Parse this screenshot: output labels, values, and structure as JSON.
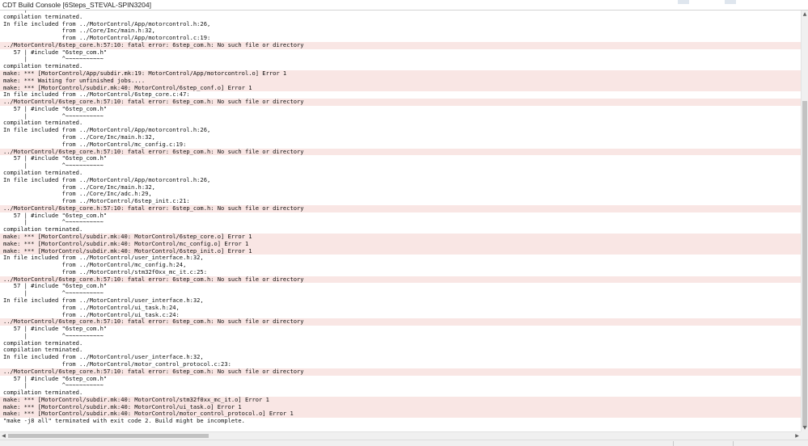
{
  "window": {
    "title": "CDT Build Console [6Steps_STEVAL-SPIN3204]"
  },
  "scrollbars": {
    "up_arrow": "▲",
    "down_arrow": "▼",
    "left_arrow": "◀",
    "right_arrow": "▶"
  },
  "colors": {
    "error_line_background": "#f9e6e4",
    "text": "#111111"
  },
  "console": {
    "lines": [
      {
        "text": "      |          ^~~~~~~~~~~~",
        "type": "normal"
      },
      {
        "text": "compilation terminated.",
        "type": "normal"
      },
      {
        "text": "In file included from ../MotorControl/App/motorcontrol.h:26,",
        "type": "normal"
      },
      {
        "text": "                 from ../Core/Inc/main.h:32,",
        "type": "normal"
      },
      {
        "text": "                 from ../MotorControl/App/motorcontrol.c:19:",
        "type": "normal"
      },
      {
        "text": "../MotorControl/6step_core.h:57:10: fatal error: 6step_com.h: No such file or directory",
        "type": "error"
      },
      {
        "text": "   57 | #include \"6step_com.h\"",
        "type": "normal"
      },
      {
        "text": "      |          ^~~~~~~~~~~~",
        "type": "normal"
      },
      {
        "text": "compilation terminated.",
        "type": "normal"
      },
      {
        "text": "make: *** [MotorControl/App/subdir.mk:19: MotorControl/App/motorcontrol.o] Error 1",
        "type": "error"
      },
      {
        "text": "make: *** Waiting for unfinished jobs....",
        "type": "error"
      },
      {
        "text": "make: *** [MotorControl/subdir.mk:40: MotorControl/6step_conf.o] Error 1",
        "type": "error"
      },
      {
        "text": "In file included from ../MotorControl/6step_core.c:47:",
        "type": "normal"
      },
      {
        "text": "../MotorControl/6step_core.h:57:10: fatal error: 6step_com.h: No such file or directory",
        "type": "error"
      },
      {
        "text": "   57 | #include \"6step_com.h\"",
        "type": "normal"
      },
      {
        "text": "      |          ^~~~~~~~~~~~",
        "type": "normal"
      },
      {
        "text": "compilation terminated.",
        "type": "normal"
      },
      {
        "text": "In file included from ../MotorControl/App/motorcontrol.h:26,",
        "type": "normal"
      },
      {
        "text": "                 from ../Core/Inc/main.h:32,",
        "type": "normal"
      },
      {
        "text": "                 from ../MotorControl/mc_config.c:19:",
        "type": "normal"
      },
      {
        "text": "../MotorControl/6step_core.h:57:10: fatal error: 6step_com.h: No such file or directory",
        "type": "error"
      },
      {
        "text": "   57 | #include \"6step_com.h\"",
        "type": "normal"
      },
      {
        "text": "      |          ^~~~~~~~~~~~",
        "type": "normal"
      },
      {
        "text": "compilation terminated.",
        "type": "normal"
      },
      {
        "text": "In file included from ../MotorControl/App/motorcontrol.h:26,",
        "type": "normal"
      },
      {
        "text": "                 from ../Core/Inc/main.h:32,",
        "type": "normal"
      },
      {
        "text": "                 from ../Core/Inc/adc.h:29,",
        "type": "normal"
      },
      {
        "text": "                 from ../MotorControl/6step_init.c:21:",
        "type": "normal"
      },
      {
        "text": "../MotorControl/6step_core.h:57:10: fatal error: 6step_com.h: No such file or directory",
        "type": "error"
      },
      {
        "text": "   57 | #include \"6step_com.h\"",
        "type": "normal"
      },
      {
        "text": "      |          ^~~~~~~~~~~~",
        "type": "normal"
      },
      {
        "text": "compilation terminated.",
        "type": "normal"
      },
      {
        "text": "make: *** [MotorControl/subdir.mk:40: MotorControl/6step_core.o] Error 1",
        "type": "error"
      },
      {
        "text": "make: *** [MotorControl/subdir.mk:40: MotorControl/mc_config.o] Error 1",
        "type": "error"
      },
      {
        "text": "make: *** [MotorControl/subdir.mk:40: MotorControl/6step_init.o] Error 1",
        "type": "error"
      },
      {
        "text": "In file included from ../MotorControl/user_interface.h:32,",
        "type": "normal"
      },
      {
        "text": "                 from ../MotorControl/mc_config.h:24,",
        "type": "normal"
      },
      {
        "text": "                 from ../MotorControl/stm32f0xx_mc_it.c:25:",
        "type": "normal"
      },
      {
        "text": "../MotorControl/6step_core.h:57:10: fatal error: 6step_com.h: No such file or directory",
        "type": "error"
      },
      {
        "text": "   57 | #include \"6step_com.h\"",
        "type": "normal"
      },
      {
        "text": "      |          ^~~~~~~~~~~~",
        "type": "normal"
      },
      {
        "text": "In file included from ../MotorControl/user_interface.h:32,",
        "type": "normal"
      },
      {
        "text": "                 from ../MotorControl/ui_task.h:24,",
        "type": "normal"
      },
      {
        "text": "                 from ../MotorControl/ui_task.c:24:",
        "type": "normal"
      },
      {
        "text": "../MotorControl/6step_core.h:57:10: fatal error: 6step_com.h: No such file or directory",
        "type": "error"
      },
      {
        "text": "   57 | #include \"6step_com.h\"",
        "type": "normal"
      },
      {
        "text": "      |          ^~~~~~~~~~~~",
        "type": "normal"
      },
      {
        "text": "compilation terminated.",
        "type": "normal"
      },
      {
        "text": "compilation terminated.",
        "type": "normal"
      },
      {
        "text": "In file included from ../MotorControl/user_interface.h:32,",
        "type": "normal"
      },
      {
        "text": "                 from ../MotorControl/motor_control_protocol.c:23:",
        "type": "normal"
      },
      {
        "text": "../MotorControl/6step_core.h:57:10: fatal error: 6step_com.h: No such file or directory",
        "type": "error"
      },
      {
        "text": "   57 | #include \"6step_com.h\"",
        "type": "normal"
      },
      {
        "text": "      |          ^~~~~~~~~~~~",
        "type": "normal"
      },
      {
        "text": "compilation terminated.",
        "type": "normal"
      },
      {
        "text": "make: *** [MotorControl/subdir.mk:40: MotorControl/stm32f0xx_mc_it.o] Error 1",
        "type": "error"
      },
      {
        "text": "make: *** [MotorControl/subdir.mk:40: MotorControl/ui_task.o] Error 1",
        "type": "error"
      },
      {
        "text": "make: *** [MotorControl/subdir.mk:40: MotorControl/motor_control_protocol.o] Error 1",
        "type": "error"
      },
      {
        "text": "\"make -j8 all\" terminated with exit code 2. Build might be incomplete.",
        "type": "normal"
      }
    ]
  }
}
